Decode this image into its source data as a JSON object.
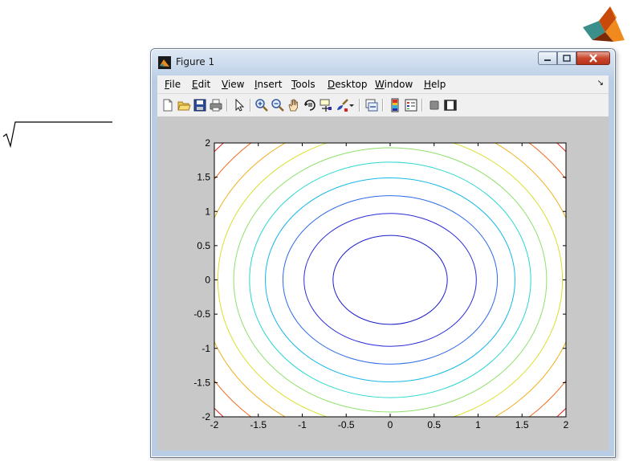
{
  "window": {
    "title": "Figure 1",
    "menu": [
      "File",
      "Edit",
      "View",
      "Insert",
      "Tools",
      "Desktop",
      "Window",
      "Help"
    ],
    "toolbar_icons": [
      "new-figure-icon",
      "open-file-icon",
      "save-icon",
      "print-icon",
      "edit-plot-icon",
      "zoom-in-icon",
      "zoom-out-icon",
      "pan-icon",
      "rotate-3d-icon",
      "data-cursor-icon",
      "brush-icon",
      "link-plot-icon",
      "colorbar-icon",
      "legend-icon",
      "hide-plot-tools-icon",
      "show-plot-tools-icon"
    ]
  },
  "chart_data": {
    "type": "contour",
    "x_ticks": [
      "-2",
      "-1.5",
      "-1",
      "-0.5",
      "0",
      "0.5",
      "1",
      "1.5",
      "2"
    ],
    "y_ticks": [
      "2",
      "1.5",
      "1",
      "0.5",
      "0",
      "-0.5",
      "-1",
      "-1.5",
      "-2"
    ],
    "xlim": [
      -2,
      2
    ],
    "ylim": [
      -2,
      2
    ],
    "contours": [
      {
        "a": 0.65,
        "b": 0.65,
        "color": "#1e1ec8"
      },
      {
        "a": 0.98,
        "b": 0.97,
        "color": "#2a2ad8"
      },
      {
        "a": 1.22,
        "b": 1.23,
        "color": "#2c6ae8"
      },
      {
        "a": 1.42,
        "b": 1.49,
        "color": "#18b8e8"
      },
      {
        "a": 1.6,
        "b": 1.72,
        "color": "#2ad8d0"
      },
      {
        "a": 1.78,
        "b": 1.93,
        "color": "#8ee06a"
      },
      {
        "a": 1.96,
        "b": 2.15,
        "color": "#d8e02a"
      },
      {
        "a": 2.16,
        "b": 2.4,
        "color": "#f0b020"
      },
      {
        "a": 2.4,
        "b": 2.66,
        "color": "#f06a1e"
      },
      {
        "a": 2.62,
        "b": 2.9,
        "color": "#e02a1a"
      }
    ],
    "grid": false
  }
}
